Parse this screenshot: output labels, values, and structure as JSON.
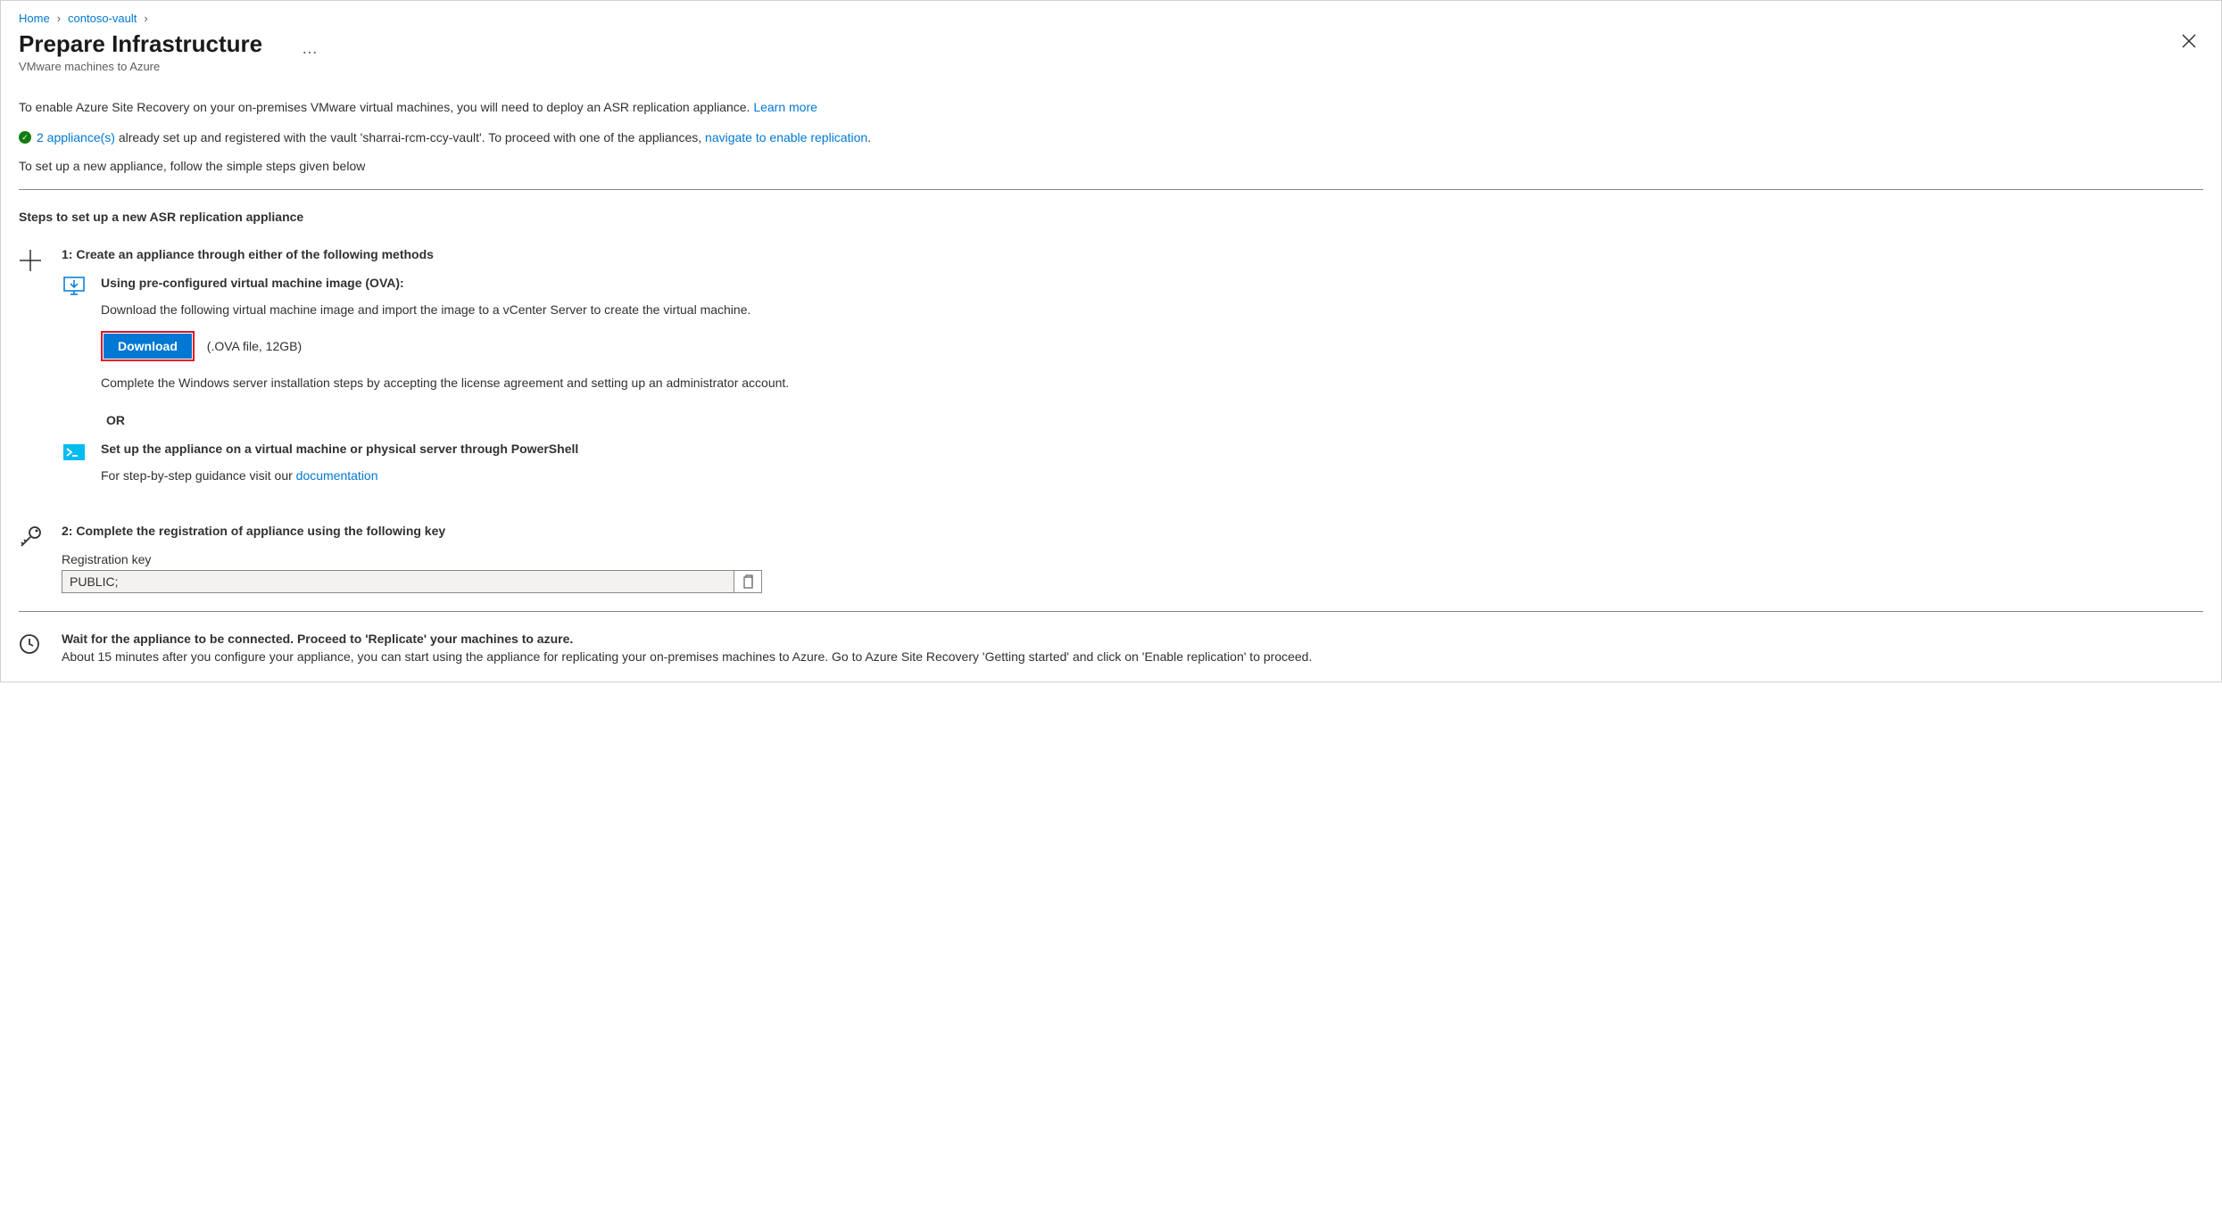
{
  "breadcrumb": {
    "home": "Home",
    "vault": "contoso-vault"
  },
  "header": {
    "title": "Prepare Infrastructure",
    "subtitle": "VMware machines to Azure",
    "more_label": "…"
  },
  "intro": {
    "line1_prefix": "To enable Azure Site Recovery on your on-premises VMware virtual machines, you will need to deploy an ASR replication appliance. ",
    "learn_more": "Learn more",
    "status_link": "2 appliance(s)",
    "status_mid": " already set up and registered with the vault 'sharrai-rcm-ccy-vault'. To proceed with one of the appliances, ",
    "status_nav": "navigate to enable replication",
    "status_end": ".",
    "line3": "To set up a new appliance, follow the simple steps given below"
  },
  "steps_heading": "Steps to set up a new ASR replication appliance",
  "step1": {
    "title": "1: Create an appliance through either of the following methods",
    "methodA": {
      "heading": "Using pre-configured virtual machine image (OVA):",
      "desc": "Download the following virtual machine image and import the image to a vCenter Server to create the virtual machine.",
      "download_label": "Download",
      "file_hint": "(.OVA file, 12GB)",
      "post": "Complete the Windows server installation steps by accepting the license agreement and setting up an administrator account."
    },
    "or_label": "OR",
    "methodB": {
      "heading": "Set up the appliance on a virtual machine or physical server through PowerShell",
      "desc_prefix": "For step-by-step guidance visit our ",
      "doc_link": "documentation"
    }
  },
  "step2": {
    "title": "2: Complete the registration of appliance using the following key",
    "label": "Registration key",
    "value": "PUBLIC;"
  },
  "wait": {
    "heading": "Wait for the appliance to be connected. Proceed to 'Replicate' your machines to azure.",
    "desc": "About 15 minutes after you configure your appliance, you can start using the appliance for replicating your on-premises machines to Azure. Go to Azure Site Recovery 'Getting started' and click on 'Enable replication' to proceed."
  }
}
